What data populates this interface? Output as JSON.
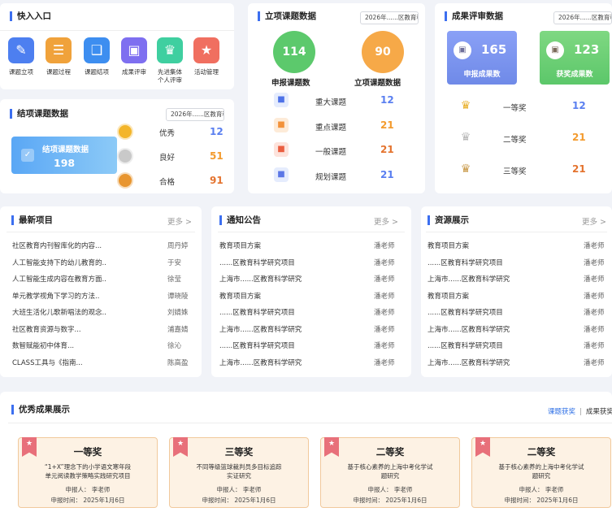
{
  "quick_entry": {
    "title": "快入入口",
    "items": [
      {
        "label": "课题立项",
        "icon": "pen-icon",
        "color": "#4d7ff0",
        "glyph": "✎"
      },
      {
        "label": "课题过程",
        "icon": "document-search-icon",
        "color": "#f0a23b",
        "glyph": "☰"
      },
      {
        "label": "课题结项",
        "icon": "book-icon",
        "color": "#3d8ef0",
        "glyph": "❑"
      },
      {
        "label": "成果评审",
        "icon": "folder-icon",
        "color": "#7e6ff0",
        "glyph": "▣"
      },
      {
        "label": "先进集体\n个人评审",
        "icon": "trophy-icon",
        "color": "#3fcfa0",
        "glyph": "♛"
      },
      {
        "label": "活动管理",
        "icon": "star-icon",
        "color": "#f06f60",
        "glyph": "★"
      }
    ]
  },
  "closing": {
    "title": "结项课题数据",
    "select": "2026年......区教育科",
    "box_label": "结项课题数据",
    "box_value": "198",
    "rows": [
      {
        "label": "优秀",
        "value": "12",
        "color": "#5a7ff0",
        "medal": "#f3b52a"
      },
      {
        "label": "良好",
        "value": "51",
        "color": "#f39b2e",
        "medal": "#c9c9c9"
      },
      {
        "label": "合格",
        "value": "91",
        "color": "#e4732e",
        "medal": "#e8952f"
      }
    ]
  },
  "project": {
    "title": "立项课题数据",
    "select": "2026年......区教育科",
    "declared_value": "114",
    "declared_label": "申报课题数",
    "approved_value": "90",
    "approved_label": "立项课题数据",
    "rows": [
      {
        "label": "重大课题",
        "value": "12",
        "color": "#5a7ff0",
        "icon_bg": "#e5ecfd",
        "icon_color": "#4d72e8"
      },
      {
        "label": "重点课题",
        "value": "21",
        "color": "#f39b2e",
        "icon_bg": "#fdebd8",
        "icon_color": "#f2923a"
      },
      {
        "label": "一般课题",
        "value": "21",
        "color": "#e4732e",
        "icon_bg": "#fde3dc",
        "icon_color": "#ea5e40"
      },
      {
        "label": "规划课题",
        "value": "21",
        "color": "#5a7ff0",
        "icon_bg": "#e5ecfd",
        "icon_color": "#5b77e6"
      }
    ]
  },
  "review": {
    "title": "成果评审数据",
    "select": "2026年......区教育科",
    "declared_value": "165",
    "declared_label": "申报成果数",
    "awarded_value": "123",
    "awarded_label": "获奖成果数",
    "rows": [
      {
        "label": "一等奖",
        "value": "12",
        "color": "#5a7ff0",
        "cup": "#e9b02b"
      },
      {
        "label": "二等奖",
        "value": "21",
        "color": "#f39b2e",
        "cup": "#b8b8b8"
      },
      {
        "label": "三等奖",
        "value": "21",
        "color": "#e4732e",
        "cup": "#c99a4a"
      }
    ]
  },
  "latest": {
    "title": "最新项目",
    "more": "更多 >",
    "rows": [
      {
        "text": "社区教育内刊智库化的内容...",
        "author": "周丹婷"
      },
      {
        "text": "人工智能支持下的幼儿教育的..",
        "author": "于安"
      },
      {
        "text": "人工智能生成内容在教育方面..",
        "author": "徐莹"
      },
      {
        "text": "单元教学视角下学习的方法..",
        "author": "谭晓陵"
      },
      {
        "text": "大班生活化儿歌新唱法的观念..",
        "author": "刘婧姝"
      },
      {
        "text": "社区教育资源与数字...",
        "author": "浦嘉婧"
      },
      {
        "text": "数智赋能初中体育...",
        "author": "徐沁"
      },
      {
        "text": "CLASS工具与《指南...",
        "author": "陈高盈"
      }
    ]
  },
  "notice": {
    "title": "通知公告",
    "more": "更多 >",
    "rows": [
      {
        "text": "教育项目方案",
        "author": "潘老师"
      },
      {
        "text": "......区教育科学研究项目",
        "author": "潘老师"
      },
      {
        "text": "上海市......区教育科学研究",
        "author": "潘老师"
      },
      {
        "text": "教育项目方案",
        "author": "潘老师"
      },
      {
        "text": "......区教育科学研究项目",
        "author": "潘老师"
      },
      {
        "text": "上海市......区教育科学研究",
        "author": "潘老师"
      },
      {
        "text": "......区教育科学研究项目",
        "author": "潘老师"
      },
      {
        "text": "上海市......区教育科学研究",
        "author": "潘老师"
      }
    ]
  },
  "resources": {
    "title": "资源展示",
    "more": "更多 >",
    "rows": [
      {
        "text": "教育项目方案",
        "author": "潘老师"
      },
      {
        "text": "......区教育科学研究项目",
        "author": "潘老师"
      },
      {
        "text": "上海市......区教育科学研究",
        "author": "潘老师"
      },
      {
        "text": "教育项目方案",
        "author": "潘老师"
      },
      {
        "text": "......区教育科学研究项目",
        "author": "潘老师"
      },
      {
        "text": "上海市......区教育科学研究",
        "author": "潘老师"
      },
      {
        "text": "......区教育科学研究项目",
        "author": "潘老师"
      },
      {
        "text": "上海市......区教育科学研究",
        "author": "潘老师"
      }
    ]
  },
  "showcase": {
    "title": "优秀成果展示",
    "tab_active": "课题获奖",
    "tab_sep": "|",
    "tab_other": "成果获奖",
    "cards": [
      {
        "level": "一等奖",
        "title": "“1+X”理念下的小学语文寒年段\n单元阅读教学策略实践研究项目",
        "applicant": "申报人：   李老师",
        "date": "申报时间：  2025年1月6日"
      },
      {
        "level": "三等奖",
        "title": "不同等级篮球裁判员多目标追踪\n实证研究",
        "applicant": "申报人：   李老师",
        "date": "申报时间：  2025年1月6日"
      },
      {
        "level": "二等奖",
        "title": "基于核心素养的上海中考化学试\n题研究",
        "applicant": "申报人：   李老师",
        "date": "申报时间：  2025年1月6日"
      },
      {
        "level": "二等奖",
        "title": "基于核心素养的上海中考化学试\n题研究",
        "applicant": "申报人：   李老师",
        "date": "申报时间：  2025年1月6日"
      }
    ]
  }
}
